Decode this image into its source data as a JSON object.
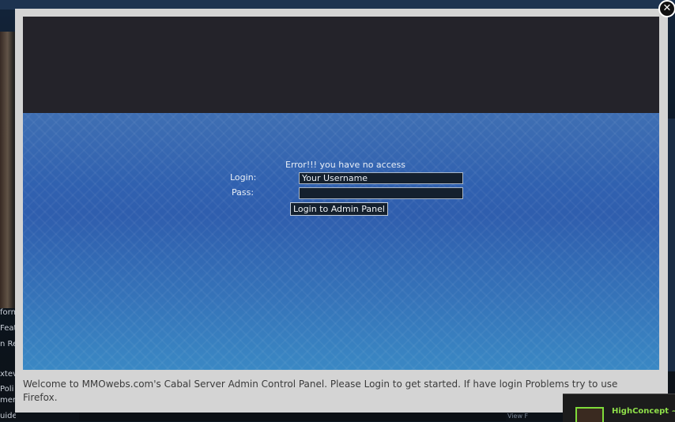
{
  "background": {
    "left_texts": [
      "forn",
      "Feat",
      "n Re",
      "xtev",
      "Poli",
      "men",
      "uide"
    ],
    "view_label": "View F"
  },
  "login_box": {
    "error_message": "Error!!! you have no access",
    "login_label": "Login:",
    "username_value": "Your Username",
    "pass_label": "Pass:",
    "password_value": "",
    "submit_label": "Login to Admin Panel"
  },
  "caption": "Welcome to MMOwebs.com's Cabal Server Admin Control Panel. Please Login to get started. If have login Problems try to use Firefox.",
  "close_button": {
    "glyph": "✕",
    "icon": "close-icon"
  },
  "chat_notification": {
    "name": "HighConcept ~ F"
  },
  "colors": {
    "header_dark": "#24232a",
    "body_blue": "#3061b0",
    "lightbox_gray": "#d4d4d4",
    "chat_green": "#8fe04a"
  }
}
